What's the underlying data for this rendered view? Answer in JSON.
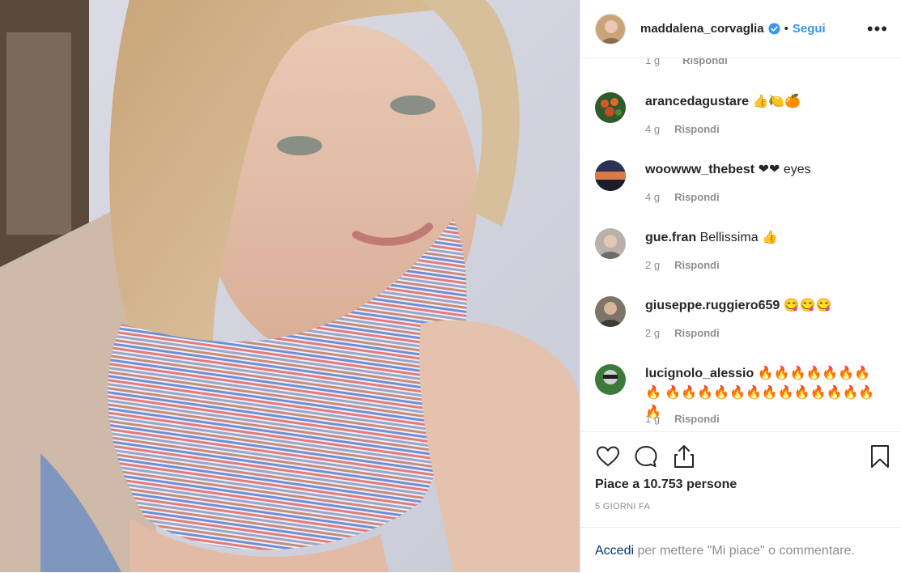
{
  "post": {
    "author": "maddalena_corvaglia",
    "dot": "•",
    "follow_label": "Segui",
    "more_label": "•••",
    "likes_prefix": "Piace a ",
    "likes_count": "10.753",
    "likes_suffix": " persone",
    "time_ago": "5 GIORNI FA"
  },
  "partial_comment": {
    "time": "1 g",
    "reply": "Rispondi"
  },
  "comments": [
    {
      "user": "arancedagustare",
      "text": " 👍🍋🍊",
      "time": "4 g",
      "reply": "Rispondi"
    },
    {
      "user": "woowww_thebest",
      "text": " ❤❤ eyes",
      "time": "4 g",
      "reply": "Rispondi"
    },
    {
      "user": "gue.fran",
      "text": " Bellissima 👍",
      "time": "2 g",
      "reply": "Rispondi"
    },
    {
      "user": "giuseppe.ruggiero659",
      "text": " 😋😋😋",
      "time": "2 g",
      "reply": "Rispondi"
    },
    {
      "user": "lucignolo_alessio",
      "text": " 🔥🔥🔥🔥🔥🔥🔥🔥 🔥🔥🔥🔥🔥🔥🔥🔥🔥🔥🔥🔥🔥🔥",
      "time": "1 g",
      "reply": "Rispondi"
    }
  ],
  "login": {
    "link": "Accedi",
    "text": " per mettere \"Mi piace\" o commentare."
  },
  "colors": {
    "accent": "#3897f0",
    "link": "#003569",
    "muted": "#8e8e8e",
    "heart": "#ed4956"
  },
  "icons": [
    "heart-icon",
    "comment-icon",
    "share-icon",
    "bookmark-icon",
    "verified-icon",
    "more-icon"
  ]
}
